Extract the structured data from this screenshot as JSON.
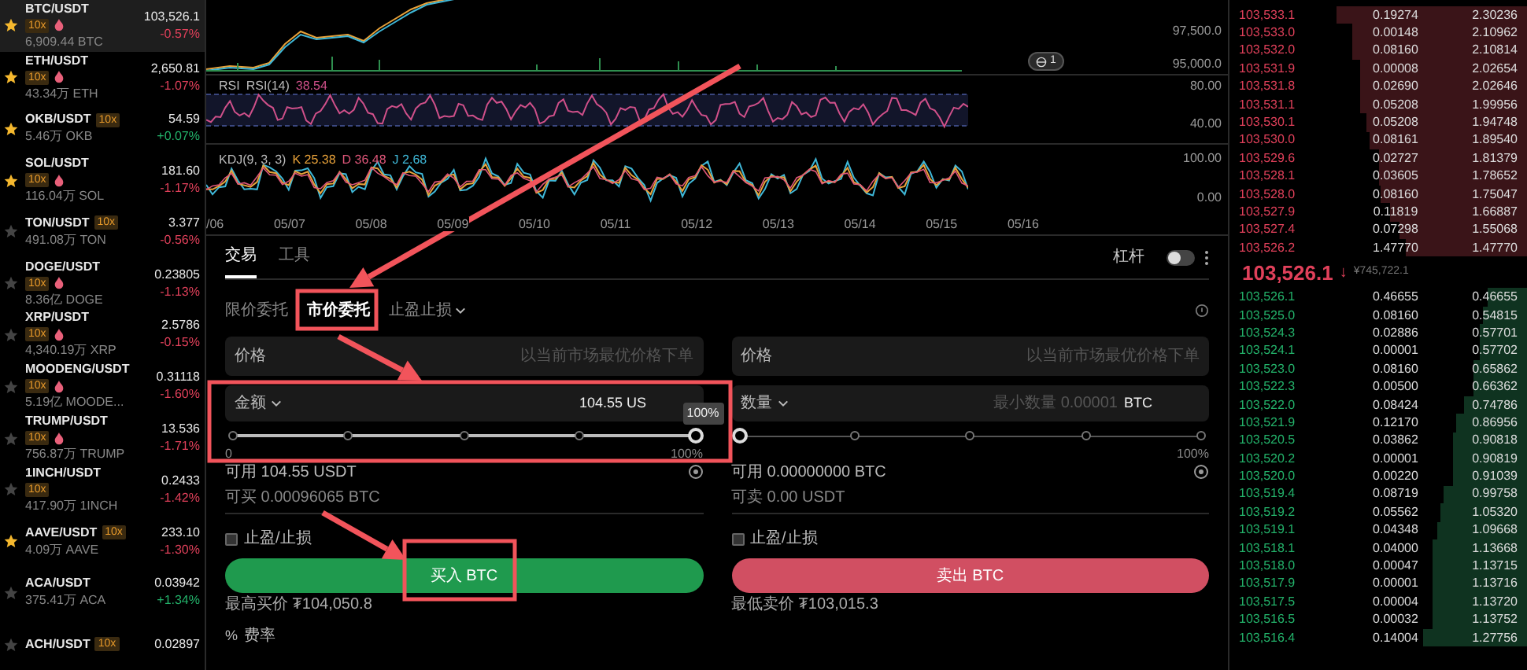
{
  "sidebar": {
    "pairs": [
      {
        "name": "BTC/USDT",
        "favorite": true,
        "selected": true,
        "kind": "stacked",
        "leverage": "10x",
        "hot": true,
        "volume": "6,909.44 BTC",
        "price": "103,526.1",
        "change": "-0.57%",
        "color": "#e0405a"
      },
      {
        "name": "ETH/USDT",
        "favorite": true,
        "selected": false,
        "kind": "stacked",
        "leverage": "10x",
        "hot": true,
        "volume": "43.34万 ETH",
        "price": "2,650.81",
        "change": "-1.07%",
        "color": "#e0405a"
      },
      {
        "name": "OKB/USDT",
        "favorite": true,
        "selected": false,
        "kind": "inline",
        "leverage": "10x",
        "hot": false,
        "volume": "5.46万 OKB",
        "price": "54.59",
        "change": "+0.07%",
        "color": "#23b26a"
      },
      {
        "name": "SOL/USDT",
        "favorite": true,
        "selected": false,
        "kind": "stacked",
        "leverage": "10x",
        "hot": true,
        "volume": "116.04万 SOL",
        "price": "181.60",
        "change": "-1.17%",
        "color": "#e0405a"
      },
      {
        "name": "TON/USDT",
        "favorite": false,
        "selected": false,
        "kind": "inline",
        "leverage": "10x",
        "hot": false,
        "volume": "491.08万 TON",
        "price": "3.377",
        "change": "-0.56%",
        "color": "#e0405a"
      },
      {
        "name": "DOGE/USDT",
        "favorite": false,
        "selected": false,
        "kind": "stacked",
        "leverage": "10x",
        "hot": true,
        "volume": "8.36亿 DOGE",
        "price": "0.23805",
        "change": "-1.13%",
        "color": "#e0405a"
      },
      {
        "name": "XRP/USDT",
        "favorite": false,
        "selected": false,
        "kind": "stacked",
        "leverage": "10x",
        "hot": true,
        "volume": "4,340.19万 XRP",
        "price": "2.5786",
        "change": "-0.15%",
        "color": "#e0405a"
      },
      {
        "name": "MOODENG/USDT",
        "favorite": false,
        "selected": false,
        "kind": "stacked",
        "leverage": "10x",
        "hot": true,
        "volume": "5.19亿 MOODE...",
        "price": "0.31118",
        "change": "-1.60%",
        "color": "#e0405a"
      },
      {
        "name": "TRUMP/USDT",
        "favorite": false,
        "selected": false,
        "kind": "stacked",
        "leverage": "10x",
        "hot": true,
        "volume": "756.87万 TRUMP",
        "price": "13.536",
        "change": "-1.71%",
        "color": "#e0405a"
      },
      {
        "name": "1INCH/USDT",
        "favorite": false,
        "selected": false,
        "kind": "stacked",
        "leverage": "10x",
        "hot": false,
        "volume": "417.90万 1INCH",
        "price": "0.2433",
        "change": "-1.42%",
        "color": "#e0405a"
      },
      {
        "name": "AAVE/USDT",
        "favorite": true,
        "selected": false,
        "kind": "inline",
        "leverage": "10x",
        "hot": false,
        "volume": "4.09万 AAVE",
        "price": "233.10",
        "change": "-1.30%",
        "color": "#e0405a"
      },
      {
        "name": "ACA/USDT",
        "favorite": false,
        "selected": false,
        "kind": "plain",
        "hot": false,
        "volume": "375.41万 ACA",
        "price": "0.03942",
        "change": "+1.34%",
        "color": "#23b26a"
      },
      {
        "name": "ACH/USDT",
        "favorite": false,
        "selected": false,
        "kind": "inline",
        "leverage": "10x",
        "hot": false,
        "price": "0.02897"
      }
    ]
  },
  "chart": {
    "price_axis": [
      "97,500.0",
      "95,000.0"
    ],
    "rsi_axis": [
      "80.00",
      "40.00"
    ],
    "kdj_axis": [
      "100.00",
      "0.00"
    ],
    "dates": [
      "/06",
      "05/07",
      "05/08",
      "05/09",
      "05/10",
      "05/11",
      "05/12",
      "05/13",
      "05/14",
      "05/15",
      "05/16"
    ],
    "marker_badge": "1",
    "rsi": {
      "label": "RSI",
      "params": "RSI(14)",
      "value": "38.54"
    },
    "kdj": {
      "params": "KDJ(9, 3, 3)",
      "values": [
        {
          "label": "K 25.38",
          "color": "#e8a23a"
        },
        {
          "label": "D 36.48",
          "color": "#e0577a"
        },
        {
          "label": "J 2.68",
          "color": "#3fb8d8"
        }
      ]
    }
  },
  "order_panel": {
    "tabs": [
      {
        "label": "交易",
        "selected": true
      },
      {
        "label": "工具",
        "selected": false
      }
    ],
    "leverage": {
      "label": "杠杆",
      "on": false
    },
    "order_types": [
      {
        "label": "限价委托",
        "selected": false,
        "dropdown": false
      },
      {
        "label": "市价委托",
        "selected": true,
        "dropdown": false
      },
      {
        "label": "止盈止损",
        "selected": false,
        "dropdown": true
      }
    ],
    "buy": {
      "price_label": "价格",
      "price_placeholder": "以当前市场最优价格下单",
      "amount_label": "金额",
      "amount_value": "104.55 US",
      "tooltip": "100%",
      "level": 1,
      "slider_labels": [
        "0",
        "100%"
      ],
      "available": "可用 104.55 USDT",
      "max": "可买 0.00096065 BTC",
      "tpsl": {
        "label": "止盈/止损",
        "checked": false
      },
      "button": "买入 BTC",
      "limit": "最高买价 ₮104,050.8"
    },
    "sell": {
      "price_label": "价格",
      "price_placeholder": "以当前市场最优价格下单",
      "amount_label": "数量",
      "amount_placeholder": "最小数量 0.00001",
      "unit": "BTC",
      "level": 0,
      "slider_labels": [
        "100%"
      ],
      "available": "可用 0.00000000 BTC",
      "max": "可卖 0.00 USDT",
      "tpsl": {
        "label": "止盈/止损",
        "checked": false
      },
      "button": "卖出 BTC",
      "limit": "最低卖价 ₮103,015.3"
    },
    "fee_label": "费率",
    "fee_icon": "%"
  },
  "order_book": {
    "asks": [
      {
        "price": "103,533.1",
        "amount": "0.19274",
        "total": "2.30236",
        "level": 0.64
      },
      {
        "price": "103,533.0",
        "amount": "0.00148",
        "total": "2.10962",
        "level": 0.59
      },
      {
        "price": "103,532.0",
        "amount": "0.08160",
        "total": "2.10814",
        "level": 0.59
      },
      {
        "price": "103,531.9",
        "amount": "0.00008",
        "total": "2.02654",
        "level": 0.56
      },
      {
        "price": "103,531.8",
        "amount": "0.02690",
        "total": "2.02646",
        "level": 0.56
      },
      {
        "price": "103,531.1",
        "amount": "0.05208",
        "total": "1.99956",
        "level": 0.56
      },
      {
        "price": "103,530.1",
        "amount": "0.05208",
        "total": "1.94748",
        "level": 0.54
      },
      {
        "price": "103,530.0",
        "amount": "0.08161",
        "total": "1.89540",
        "level": 0.53
      },
      {
        "price": "103,529.6",
        "amount": "0.02727",
        "total": "1.81379",
        "level": 0.5
      },
      {
        "price": "103,528.1",
        "amount": "0.03605",
        "total": "1.78652",
        "level": 0.5
      },
      {
        "price": "103,528.0",
        "amount": "0.08160",
        "total": "1.75047",
        "level": 0.49
      },
      {
        "price": "103,527.9",
        "amount": "0.11819",
        "total": "1.66887",
        "level": 0.46
      },
      {
        "price": "103,527.4",
        "amount": "0.07298",
        "total": "1.55068",
        "level": 0.43
      },
      {
        "price": "103,526.2",
        "amount": "1.47770",
        "total": "1.47770",
        "level": 0.41
      }
    ],
    "last_price": {
      "price": "103,526.1",
      "arrow": "↓",
      "converted": "¥745,722.1"
    },
    "bids": [
      {
        "price": "103,526.1",
        "amount": "0.46655",
        "total": "0.46655",
        "level": 0.13
      },
      {
        "price": "103,525.0",
        "amount": "0.08160",
        "total": "0.54815",
        "level": 0.15
      },
      {
        "price": "103,524.3",
        "amount": "0.02886",
        "total": "0.57701",
        "level": 0.16
      },
      {
        "price": "103,524.1",
        "amount": "0.00001",
        "total": "0.57702",
        "level": 0.16
      },
      {
        "price": "103,523.0",
        "amount": "0.08160",
        "total": "0.65862",
        "level": 0.18
      },
      {
        "price": "103,522.3",
        "amount": "0.00500",
        "total": "0.66362",
        "level": 0.18
      },
      {
        "price": "103,522.0",
        "amount": "0.08424",
        "total": "0.74786",
        "level": 0.21
      },
      {
        "price": "103,521.9",
        "amount": "0.12170",
        "total": "0.86956",
        "level": 0.24
      },
      {
        "price": "103,520.5",
        "amount": "0.03862",
        "total": "0.90818",
        "level": 0.25
      },
      {
        "price": "103,520.2",
        "amount": "0.00001",
        "total": "0.90819",
        "level": 0.25
      },
      {
        "price": "103,520.0",
        "amount": "0.00220",
        "total": "0.91039",
        "level": 0.25
      },
      {
        "price": "103,519.4",
        "amount": "0.08719",
        "total": "0.99758",
        "level": 0.28
      },
      {
        "price": "103,519.2",
        "amount": "0.05562",
        "total": "1.05320",
        "level": 0.29
      },
      {
        "price": "103,519.1",
        "amount": "0.04348",
        "total": "1.09668",
        "level": 0.3
      },
      {
        "price": "103,518.1",
        "amount": "0.04000",
        "total": "1.13668",
        "level": 0.32
      },
      {
        "price": "103,518.0",
        "amount": "0.00047",
        "total": "1.13715",
        "level": 0.32
      },
      {
        "price": "103,517.9",
        "amount": "0.00001",
        "total": "1.13716",
        "level": 0.32
      },
      {
        "price": "103,517.5",
        "amount": "0.00004",
        "total": "1.13720",
        "level": 0.32
      },
      {
        "price": "103,516.5",
        "amount": "0.00032",
        "total": "1.13752",
        "level": 0.32
      },
      {
        "price": "103,516.4",
        "amount": "0.14004",
        "total": "1.27756",
        "level": 0.35
      }
    ]
  }
}
